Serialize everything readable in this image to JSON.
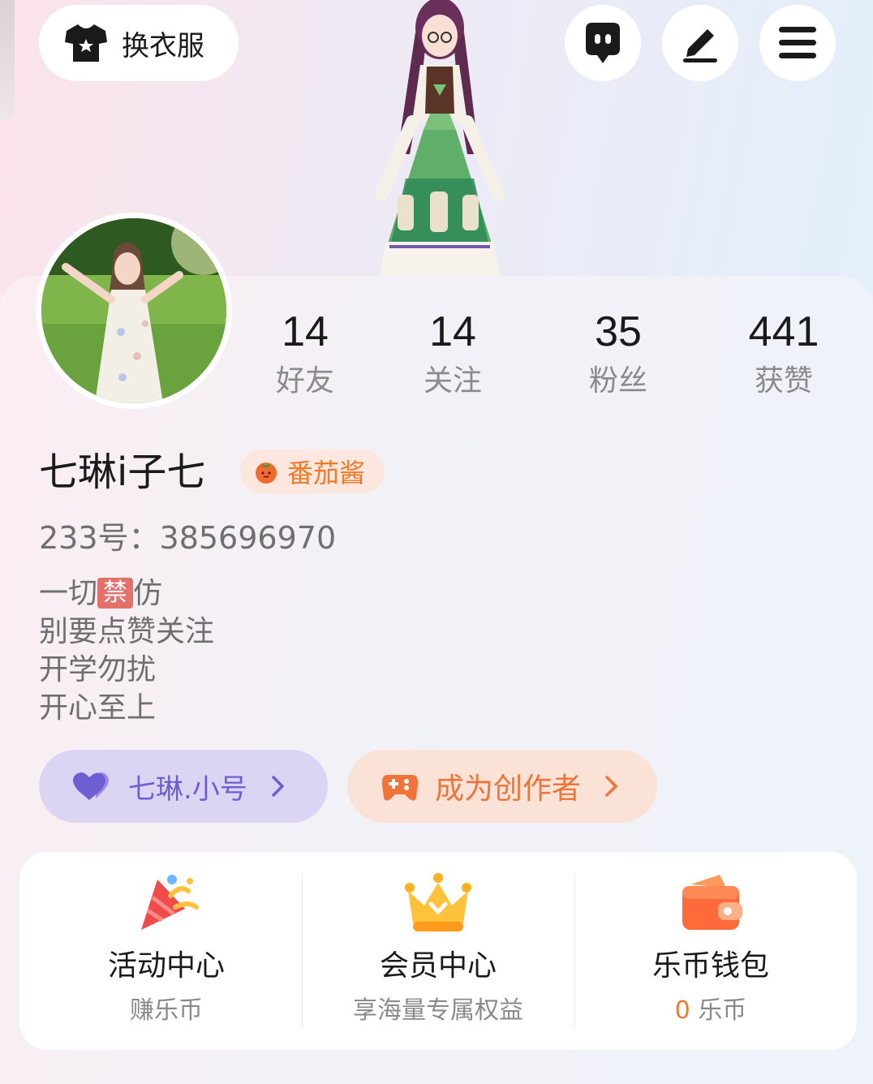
{
  "header": {
    "wardrobe_label": "换衣服",
    "icons": [
      "shirt-icon",
      "chat-bubble-icon",
      "edit-pen-icon",
      "menu-icon"
    ]
  },
  "stats": [
    {
      "value": "14",
      "label": "好友"
    },
    {
      "value": "14",
      "label": "关注"
    },
    {
      "value": "35",
      "label": "粉丝"
    },
    {
      "value": "441",
      "label": "获赞"
    }
  ],
  "profile": {
    "name": "七琳i子七",
    "tag": "番茄酱",
    "uid_label": "233号：",
    "uid": "385696970",
    "bio": {
      "line1_prefix": "一切",
      "line1_badge": "禁",
      "line1_suffix": "仿",
      "line2": "别要点赞关注",
      "line3": "开学勿扰",
      "line4": "开心至上"
    }
  },
  "chips": {
    "alt_account": "七琳.小号",
    "creator": "成为创作者"
  },
  "services": [
    {
      "title": "活动中心",
      "subtitle": "赚乐币",
      "icon": "party-popper-icon"
    },
    {
      "title": "会员中心",
      "subtitle": "享海量专属权益",
      "icon": "crown-icon"
    },
    {
      "title": "乐币钱包",
      "subtitle_value": "0",
      "subtitle": "乐币",
      "icon": "wallet-icon"
    }
  ],
  "colors": {
    "accent_orange": "#f07a2a",
    "accent_purple": "#6d5fd1"
  }
}
